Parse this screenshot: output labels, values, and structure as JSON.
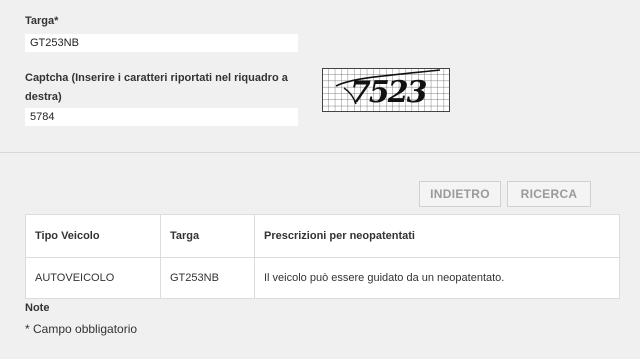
{
  "form": {
    "targa_label": "Targa*",
    "targa_value": "GT253NB",
    "captcha_label_line1": "Captcha (Inserire i caratteri riportati nel riquadro a",
    "captcha_label_line2": "destra)",
    "captcha_value": "5784",
    "captcha_image_text": "7523"
  },
  "buttons": {
    "back_label": "INDIETRO",
    "search_label": "RICERCA"
  },
  "table": {
    "headers": [
      "Tipo Veicolo",
      "Targa",
      "Prescrizioni per neopatentati"
    ],
    "rows": [
      [
        "AUTOVEICOLO",
        "GT253NB",
        "Il veicolo può essere guidato da un neopatentato."
      ]
    ]
  },
  "notes": {
    "title": "Note",
    "text": "* Campo obbligatorio"
  }
}
